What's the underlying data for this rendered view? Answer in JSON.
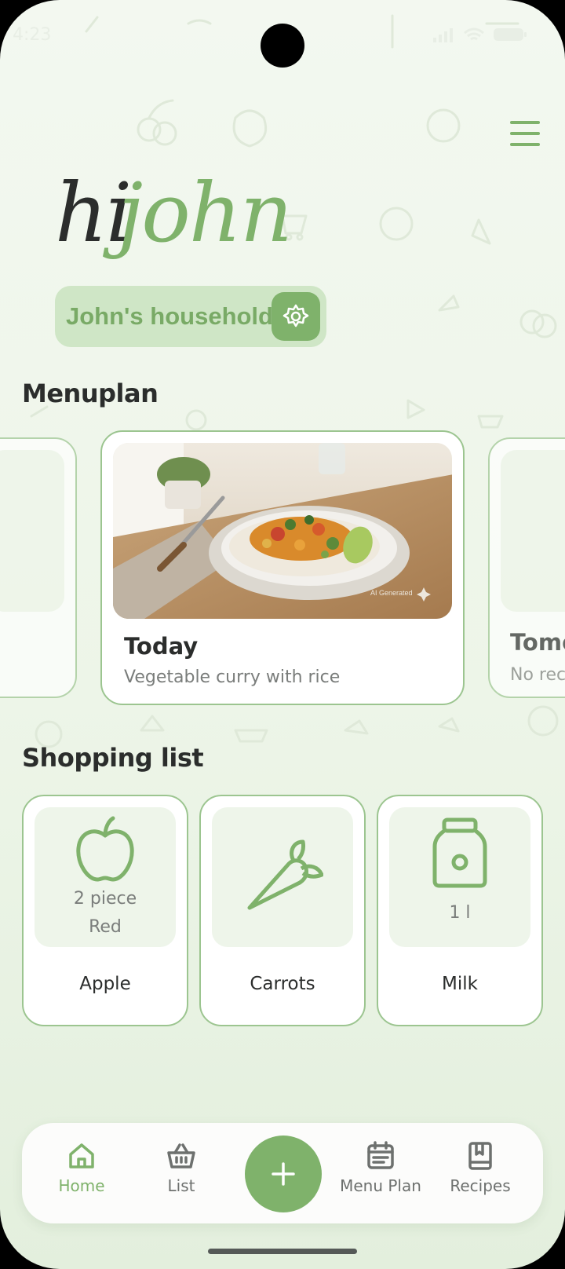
{
  "status": {
    "time": "4:23"
  },
  "header": {
    "greeting_hi": "hi",
    "greeting_name": "john",
    "menu_icon": "hamburger-menu-icon"
  },
  "household": {
    "label": "John's household",
    "icon": "gear-icon"
  },
  "menuplan": {
    "title": "Menuplan",
    "cards": [
      {
        "day": "Today",
        "meal": "Vegetable curry with rice",
        "image_label": "AI Generated"
      },
      {
        "day": "Tomo",
        "meal": "No rec"
      }
    ]
  },
  "shopping": {
    "title": "Shopping list",
    "items": [
      {
        "name": "Apple",
        "qty": "2 piece",
        "note": "Red",
        "icon": "apple-icon"
      },
      {
        "name": "Carrots",
        "qty": "",
        "note": "",
        "icon": "carrot-icon"
      },
      {
        "name": "Milk",
        "qty": "1 l",
        "note": "",
        "icon": "milk-bottle-icon"
      }
    ]
  },
  "nav": {
    "items": [
      {
        "label": "Home",
        "icon": "home-icon",
        "active": true
      },
      {
        "label": "List",
        "icon": "basket-icon"
      },
      {
        "label": "Menu Plan",
        "icon": "calendar-icon"
      },
      {
        "label": "Recipes",
        "icon": "recipe-book-icon"
      }
    ],
    "add_icon": "plus-icon"
  },
  "colors": {
    "accent": "#7fb26b",
    "accent_light": "#cfe6c6",
    "card_border": "#9cc590",
    "background": "#eef5ea"
  }
}
